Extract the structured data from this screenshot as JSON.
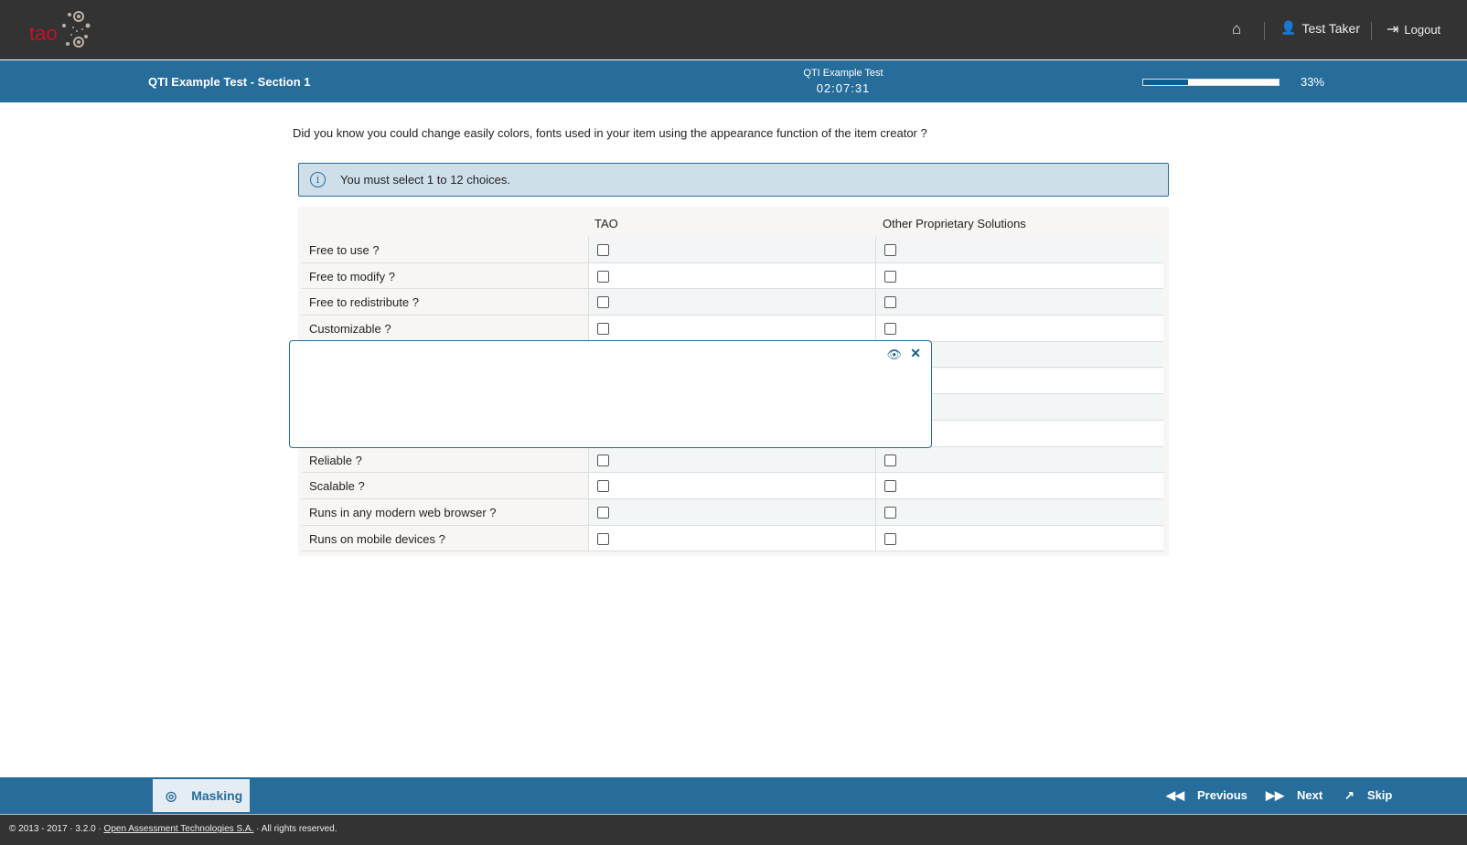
{
  "header": {
    "logo_text": "tao",
    "home_icon": "home-icon",
    "user_label": "Test Taker",
    "logout_label": "Logout"
  },
  "section": {
    "title": "QTI Example Test - Section 1",
    "test_title": "QTI Example Test",
    "timer": "02:07:31",
    "progress_percent": 33,
    "progress_label": "33%"
  },
  "item": {
    "question": "Did you know you could change easily colors, fonts used in your item using the appearance function of the item creator ?",
    "info": "You must select 1 to 12 choices.",
    "columns": [
      "TAO",
      "Other Proprietary Solutions"
    ],
    "rows": [
      "Free to use ?",
      "Free to modify ?",
      "Free to redistribute ?",
      "Customizable ?",
      "",
      "",
      "",
      "",
      "Reliable ?",
      "Scalable ?",
      "Runs in any modern web browser ?",
      "Runs on mobile devices ?"
    ]
  },
  "toolbar": {
    "masking_label": "Masking",
    "previous_label": "Previous",
    "next_label": "Next",
    "skip_label": "Skip"
  },
  "footer": {
    "prefix": "© 2013 - 2017 · 3.2.0 · ",
    "link": "Open Assessment Technologies S.A.",
    "suffix": " · All rights reserved."
  },
  "colors": {
    "brand_blue": "#266d9c",
    "dark": "#333333",
    "logo_red": "#c8102e"
  }
}
